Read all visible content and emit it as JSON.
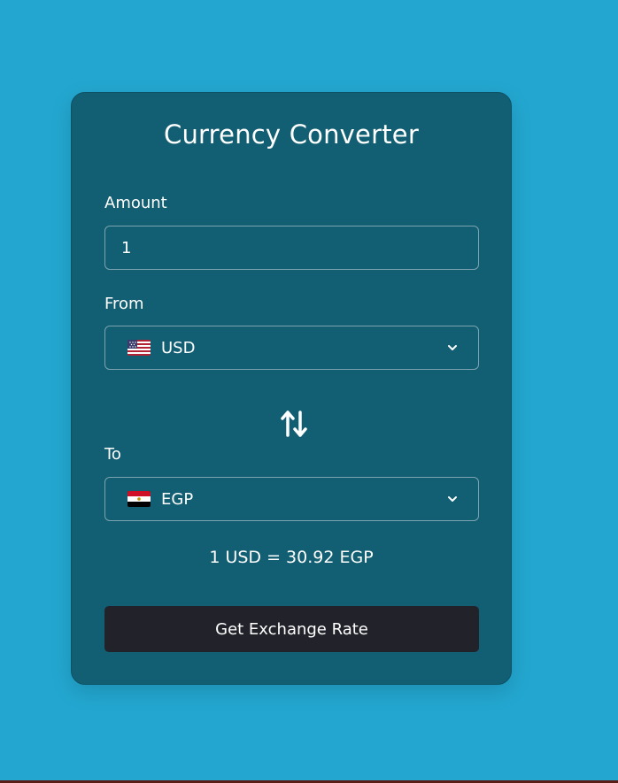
{
  "converter": {
    "title": "Currency Converter",
    "amount_label": "Amount",
    "amount_value": "1",
    "from_label": "From",
    "from_currency": "USD",
    "from_flag_icon": "us-flag-icon",
    "swap_icon": "swap-arrows-icon",
    "to_label": "To",
    "to_currency": "EGP",
    "to_flag_icon": "egypt-flag-icon",
    "rate_text": "1 USD = 30.92 EGP",
    "button_label": "Get Exchange Rate"
  },
  "colors": {
    "background": "#23a7d0",
    "card": "#125e72",
    "button": "#22222b",
    "text": "#ffffff",
    "border": "#7ca4b0"
  }
}
